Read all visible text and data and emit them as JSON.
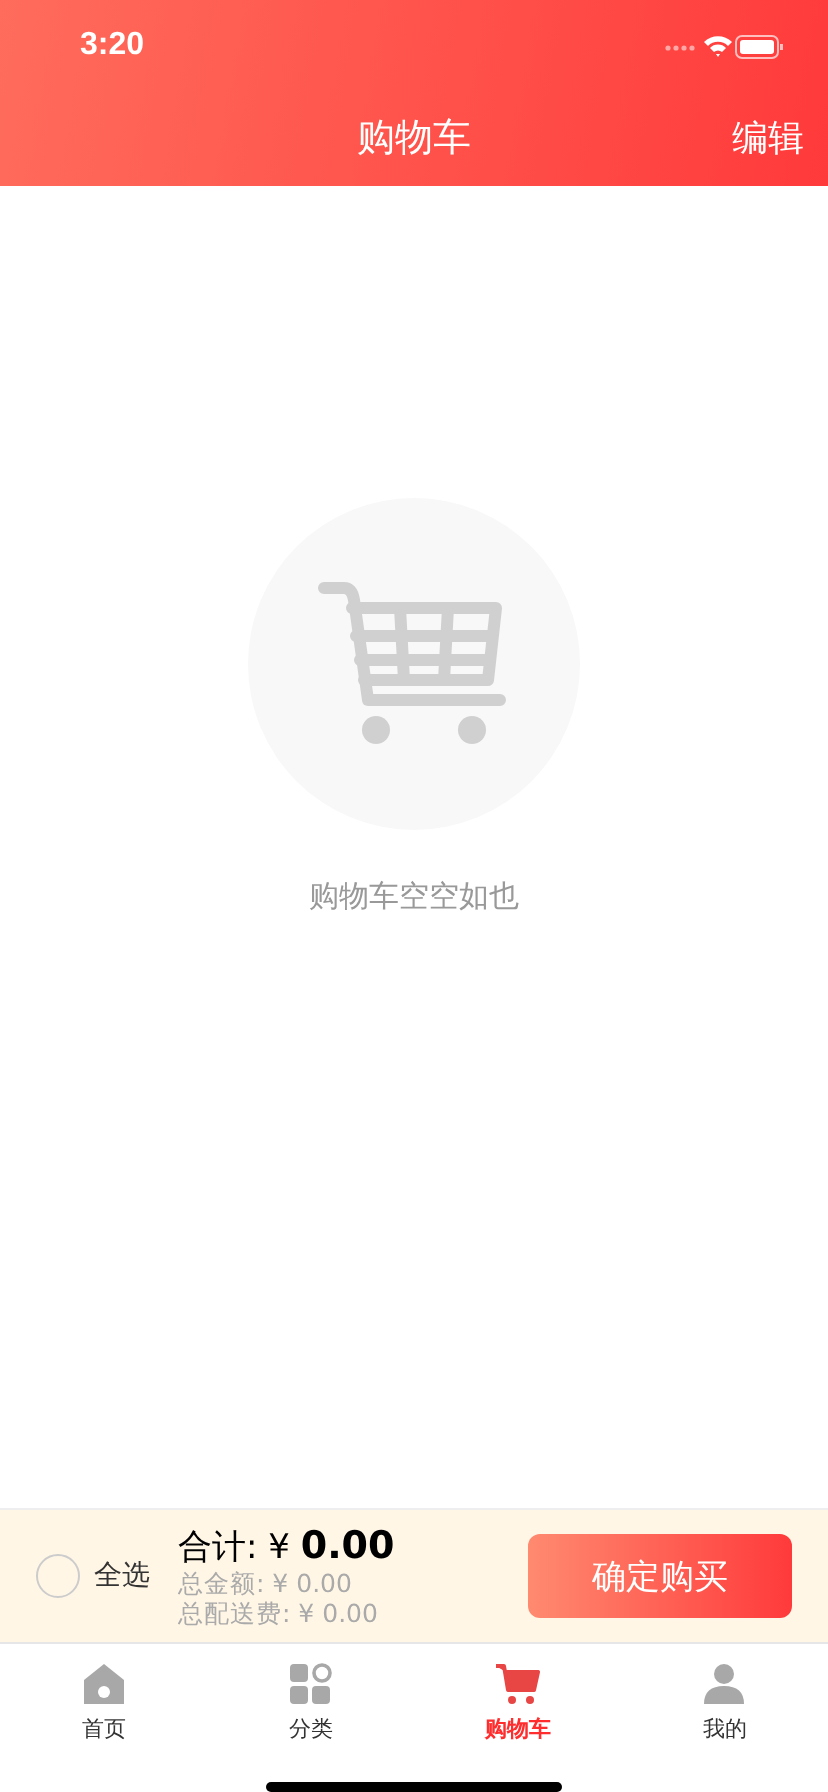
{
  "status_bar": {
    "time": "3:20"
  },
  "nav": {
    "title": "购物车",
    "action": "编辑"
  },
  "empty_state": {
    "message": "购物车空空如也"
  },
  "checkout_bar": {
    "select_all": {
      "label": "全选",
      "checked": false
    },
    "total": "合计: ¥ **0.00**",
    "amount": "总金额: ¥ 0.00",
    "delivery": "总配送费: ¥ 0.00",
    "button": "确定购买"
  },
  "tabs": [
    {
      "label": "首页",
      "kind": "home",
      "selected": false
    },
    {
      "label": "分类",
      "kind": "category",
      "selected": false
    },
    {
      "label": "购物车",
      "kind": "cart",
      "selected": true
    },
    {
      "label": "我的",
      "kind": "profile",
      "selected": false
    }
  ]
}
